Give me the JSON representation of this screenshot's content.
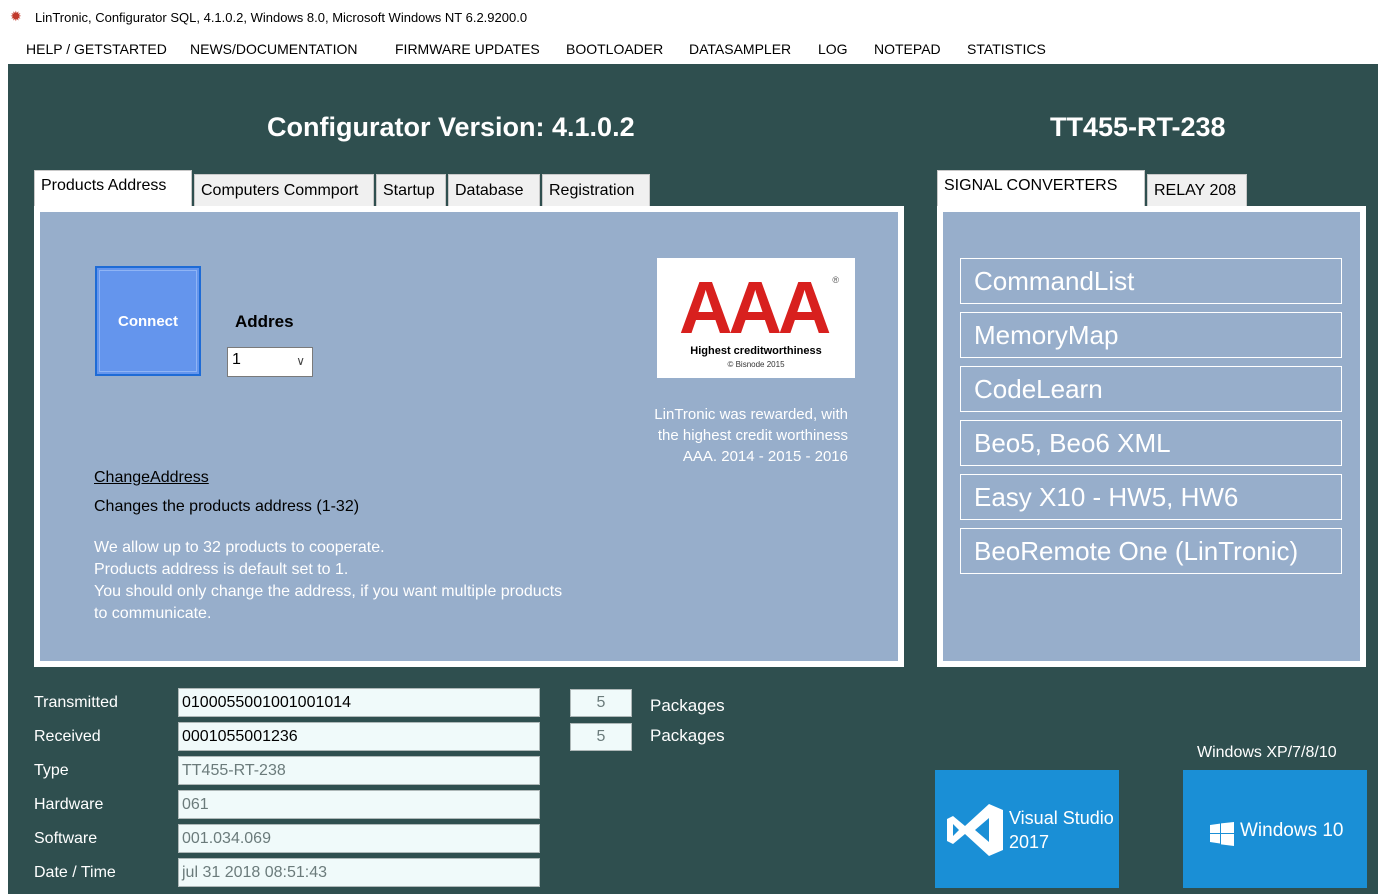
{
  "window": {
    "title": "LinTronic, Configurator SQL, 4.1.0.2, Windows 8.0, Microsoft Windows NT 6.2.9200.0"
  },
  "menu": [
    "HELP / GETSTARTED",
    "NEWS/DOCUMENTATION",
    "FIRMWARE UPDATES",
    "BOOTLOADER",
    "DATASAMPLER",
    "LOG",
    "NOTEPAD",
    "STATISTICS"
  ],
  "header": {
    "version": "Configurator Version: 4.1.0.2",
    "model": "TT455-RT-238"
  },
  "left_tabs": [
    {
      "label": "Products Address",
      "active": true
    },
    {
      "label": "Computers Commport",
      "active": false
    },
    {
      "label": "Startup",
      "active": false
    },
    {
      "label": "Database",
      "active": false
    },
    {
      "label": "Registration",
      "active": false
    }
  ],
  "address_panel": {
    "connect_label": "Connect",
    "address_label": "Addres",
    "address_value": "1",
    "badge": {
      "letters": "AAA",
      "registered": "®",
      "caption": "Highest creditworthiness",
      "copyright": "© Bisnode 2015"
    },
    "reward_lines": [
      "LinTronic was rewarded, with",
      "the highest credit worthiness",
      "AAA. 2014 - 2015 - 2016"
    ],
    "change_link": "ChangeAddress",
    "change_desc": "Changes the products address (1-32)",
    "info_lines": [
      "We allow up to 32 products to cooperate.",
      "Products address is default set to 1.",
      "You should only change the address, if you want multiple products",
      "to communicate."
    ]
  },
  "right_tabs": [
    {
      "label": "SIGNAL CONVERTERS",
      "active": true
    },
    {
      "label": "RELAY 208",
      "active": false
    }
  ],
  "signal_buttons": [
    "CommandList",
    "MemoryMap",
    "CodeLearn",
    "Beo5, Beo6 XML",
    "Easy X10 - HW5, HW6",
    "BeoRemote One (LinTronic)"
  ],
  "status": {
    "transmitted": {
      "label": "Transmitted",
      "value": "0100055001001001014",
      "count": "5",
      "unit": "Packages"
    },
    "received": {
      "label": "Received",
      "value": "0001055001236",
      "count": "5",
      "unit": "Packages"
    },
    "type": {
      "label": "Type",
      "value": "TT455-RT-238"
    },
    "hardware": {
      "label": "Hardware",
      "value": "061"
    },
    "software": {
      "label": "Software",
      "value": "001.034.069"
    },
    "datetime": {
      "label": "Date / Time",
      "value": "jul 31 2018 08:51:43"
    }
  },
  "logos": {
    "windows_label": "Windows XP/7/8/10",
    "vs_line1": "Visual Studio",
    "vs_line2": "2017",
    "win10": "Windows 10"
  },
  "colors": {
    "background": "#2f4f4f",
    "panel": "#97aecb",
    "connect": "#6495ed",
    "badge_red": "#d8201e",
    "tile_blue": "#1a8fd6"
  }
}
